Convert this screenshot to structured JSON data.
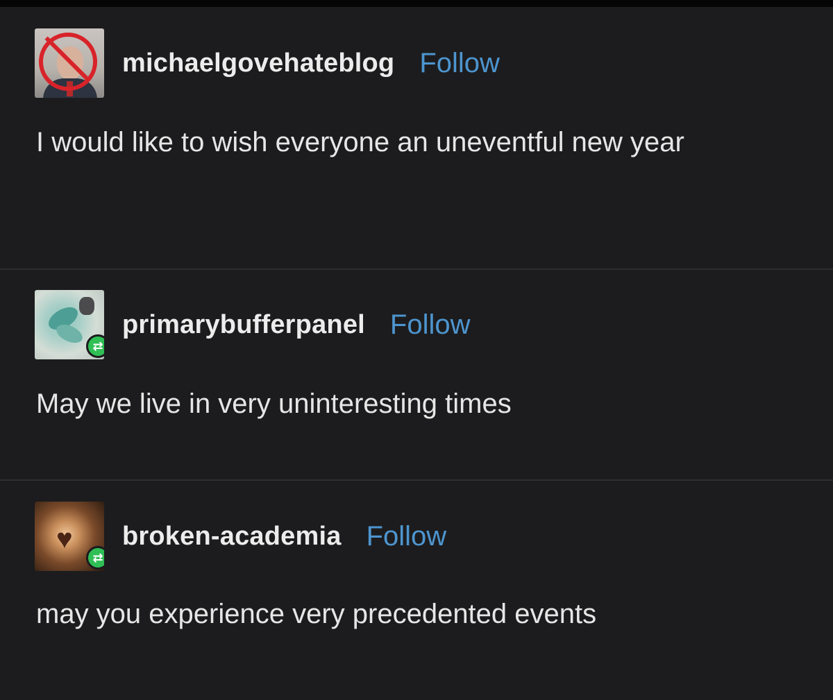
{
  "posts": [
    {
      "username": "michaelgovehateblog",
      "follow_label": "Follow",
      "body": "I would like to wish everyone an uneventful new year",
      "avatar_icon": "portrait-no-symbol-icon",
      "reblogged": false
    },
    {
      "username": "primarybufferpanel",
      "follow_label": "Follow",
      "body": "May we live in very uninteresting times",
      "avatar_icon": "floral-art-icon",
      "reblogged": true
    },
    {
      "username": "broken-academia",
      "follow_label": "Follow",
      "body": "may you experience very precedented events",
      "avatar_icon": "heart-art-icon",
      "reblogged": true
    }
  ],
  "colors": {
    "background": "#1c1c1e",
    "text": "#e6e6e6",
    "follow_link": "#4d95cf",
    "reblog_badge": "#2fbf55",
    "no_symbol": "#d8232a"
  },
  "icons": {
    "reblog": "reblog-icon"
  }
}
